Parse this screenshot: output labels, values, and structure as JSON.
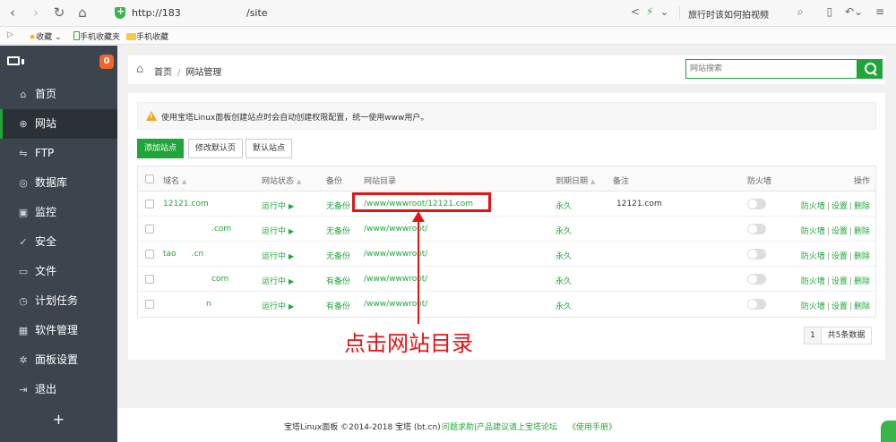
{
  "browser": {
    "url_prefix": "http://183",
    "url_suffix": "/site",
    "search_suggest": "旅行时该如何拍视频"
  },
  "bookmarks": {
    "fav": "收藏",
    "mobile_folder": "手机收藏夹",
    "mobile_fav": "手机收藏"
  },
  "sidebar": {
    "badge": "0",
    "items": [
      {
        "label": "首页",
        "icon": "home-icon"
      },
      {
        "label": "网站",
        "icon": "globe-icon"
      },
      {
        "label": "FTP",
        "icon": "ftp-icon"
      },
      {
        "label": "数据库",
        "icon": "database-icon"
      },
      {
        "label": "监控",
        "icon": "monitor-icon"
      },
      {
        "label": "安全",
        "icon": "shield-check-icon"
      },
      {
        "label": "文件",
        "icon": "folder-icon"
      },
      {
        "label": "计划任务",
        "icon": "clock-icon"
      },
      {
        "label": "软件管理",
        "icon": "grid-icon"
      },
      {
        "label": "面板设置",
        "icon": "gear-icon"
      },
      {
        "label": "退出",
        "icon": "logout-icon"
      }
    ],
    "add": "+"
  },
  "breadcrumb": {
    "home": "首页",
    "sep": "/",
    "current": "网站管理"
  },
  "search": {
    "placeholder": "网站搜索"
  },
  "alert": {
    "text": "使用宝塔Linux面板创建站点时会自动创建权限配置，统一使用www用户。"
  },
  "toolbar": {
    "add_site": "添加站点",
    "edit_default": "修改默认页",
    "default_site": "默认站点"
  },
  "table": {
    "headers": {
      "domain": "域名",
      "status": "网站状态",
      "backup": "备份",
      "dir": "网站目录",
      "expire": "到期日期",
      "note": "备注",
      "firewall": "防火墙",
      "ops": "操作"
    },
    "rows": [
      {
        "domain": "12121.com",
        "status": "运行中",
        "backup": "无备份",
        "dir": "/www/wwwroot/12121.com",
        "expire": "永久",
        "note": "12121.com"
      },
      {
        "domain": ".com",
        "status": "运行中",
        "backup": "无备份",
        "dir": "/www/wwwroot/",
        "expire": "永久",
        "note": ""
      },
      {
        "domain": "tao      .cn",
        "status": "运行中",
        "backup": "无备份",
        "dir": "/www/wwwroot/",
        "expire": "永久",
        "note": ""
      },
      {
        "domain": "com",
        "status": "运行中",
        "backup": "有备份",
        "dir": "/www/wwwroot/",
        "expire": "永久",
        "note": ""
      },
      {
        "domain": "n",
        "status": "运行中",
        "backup": "有备份",
        "dir": "/www/wwwroot/",
        "expire": "永久",
        "note": ""
      }
    ],
    "op_firewall": "防火墙",
    "op_settings": "设置",
    "op_delete": "删除",
    "op_sep": "|"
  },
  "pager": {
    "page": "1",
    "total": "共5条数据"
  },
  "annotation": {
    "callout": "点击网站目录"
  },
  "footer": {
    "copyright": "宝塔Linux面板 ©2014-2018 宝塔 (bt.cn)",
    "links": "问题求助|产品建议请上宝塔论坛",
    "manual": "《使用手册》"
  },
  "colors": {
    "accent": "#20a53a",
    "sidebar": "#3c444d",
    "annotation": "#e31414"
  }
}
